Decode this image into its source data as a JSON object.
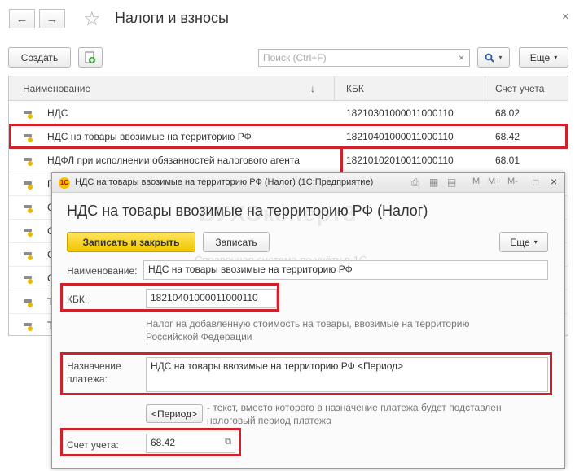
{
  "window": {
    "title": "Налоги и взносы",
    "back_icon": "←",
    "forward_icon": "→",
    "star_icon": "☆",
    "close_icon": "×"
  },
  "toolbar": {
    "create_label": "Создать",
    "search_placeholder": "Поиск (Ctrl+F)",
    "search_clear": "×",
    "search_icon": "🔍",
    "more_label": "Еще"
  },
  "table": {
    "headers": {
      "name": "Наименование",
      "sort_arrow": "↓",
      "kbk": "КБК",
      "account": "Счет учета"
    },
    "rows": [
      {
        "name": "НДС",
        "kbk": "18210301000011000110",
        "account": "68.02"
      },
      {
        "name": "НДС на товары ввозимые на территорию РФ",
        "kbk": "18210401000011000110",
        "account": "68.42"
      },
      {
        "name": "НДФЛ при исполнении обязанностей налогового агента",
        "kbk": "18210102010011000110",
        "account": "68.01"
      },
      {
        "name": "Г",
        "kbk": "",
        "account": ""
      },
      {
        "name": "С",
        "kbk": "",
        "account": ""
      },
      {
        "name": "С",
        "kbk": "",
        "account": ""
      },
      {
        "name": "С",
        "kbk": "",
        "account": ""
      },
      {
        "name": "С",
        "kbk": "",
        "account": ""
      },
      {
        "name": "Т",
        "kbk": "",
        "account": ""
      },
      {
        "name": "Т",
        "kbk": "",
        "account": ""
      }
    ]
  },
  "dialog": {
    "window_title": "НДС на товары ввозимые на территорию РФ (Налог)  (1С:Предприятие)",
    "logo_text": "1С",
    "heading": "НДС на товары ввозимые на территорию РФ (Налог)",
    "save_close_label": "Записать и закрыть",
    "save_label": "Записать",
    "more_label": "Еще",
    "watermark": "БУХЭксперт8",
    "watermark_sub": "Справочная система по учёту в 1С",
    "name_label": "Наименование:",
    "name_value": "НДС на товары ввозимые на территорию РФ",
    "kbk_label": "КБК:",
    "kbk_value": "18210401000011000110",
    "kbk_hint": "Налог на добавленную стоимость на товары, ввозимые на территорию Российской Федерации",
    "purpose_label": "Назначение платежа:",
    "purpose_value": "НДС на товары ввозимые на территорию РФ <Период>",
    "period_button": "<Период>",
    "period_hint": "- текст, вместо которого в назначение платежа будет подставлен налоговый период платежа",
    "account_label": "Счет учета:",
    "account_value": "68.42",
    "toolbar_icons": {
      "print": "⎙",
      "calc": "▦",
      "calendar": "▤",
      "m": "M",
      "mplus": "M+",
      "mminus": "M-",
      "restore": "□",
      "close": "×"
    }
  }
}
